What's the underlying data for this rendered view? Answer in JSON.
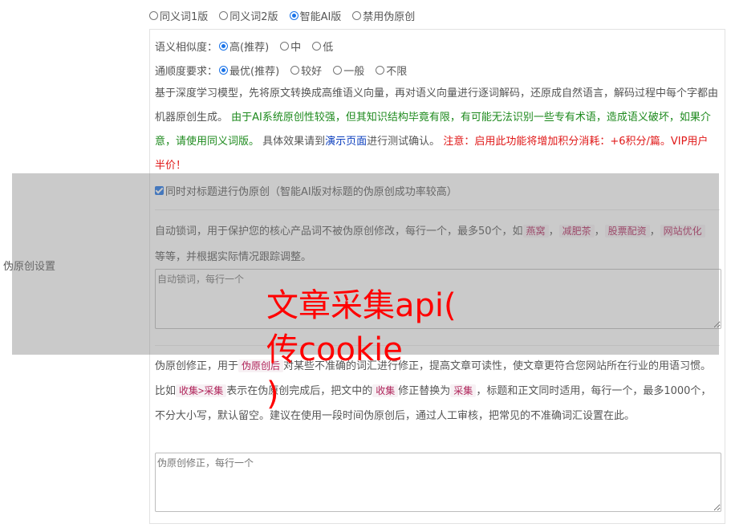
{
  "mode_options": [
    {
      "label": "同义词1版",
      "checked": false
    },
    {
      "label": "同义词2版",
      "checked": false
    },
    {
      "label": "智能AI版",
      "checked": true
    },
    {
      "label": "禁用伪原创",
      "checked": false
    }
  ],
  "similarity": {
    "label": "语义相似度：",
    "options": [
      {
        "label": "高(推荐)",
        "checked": true
      },
      {
        "label": "中",
        "checked": false
      },
      {
        "label": "低",
        "checked": false
      }
    ]
  },
  "fluency": {
    "label": "通顺度要求：",
    "options": [
      {
        "label": "最优(推荐)",
        "checked": true
      },
      {
        "label": "较好",
        "checked": false
      },
      {
        "label": "一般",
        "checked": false
      },
      {
        "label": "不限",
        "checked": false
      }
    ]
  },
  "description": {
    "part1": "基于深度学习模型，先将原文转换成高维语义向量，再对语义向量进行逐词解码，还原成自然语言，解码过程中每个字都由机器原创生成。 ",
    "warning_green": "由于AI系统原创性较强，但其知识结构毕竟有限，有可能无法识别一些专有术语，造成语义破坏，如果介意，请使用同义词版。",
    "part2": " 具体效果请到",
    "demo_link": "演示页面",
    "part3": "进行测试确认。 ",
    "warning_red": "注意：启用此功能将增加积分消耗：+6积分/篇。VIP用户半价！"
  },
  "title_checkbox": {
    "label": "同时对标题进行伪原创（智能AI版对标题的伪原创成功率较高）",
    "checked": true
  },
  "lock_words": {
    "intro": "自动锁词，用于保护您的核心产品词不被伪原创修改，每行一个，最多50个，如",
    "examples": [
      "燕窝",
      "减肥茶",
      "股票配资",
      "网站优化"
    ],
    "sep": "，",
    "outro": "等等，并根据实际情况跟踪调整。",
    "placeholder": "自动锁词，每行一个"
  },
  "side_label": "伪原创设置",
  "correction": {
    "text1": "伪原创修正，用于",
    "tag1": "伪原创后",
    "text2": "对某些不准确的词汇进行修正，提高文章可读性，使文章更符合您网站所在行业的用语习惯。比如",
    "tag2": "收集>采集",
    "text3": "表示在伪原创完成后，把文中的",
    "tag3": "收集",
    "text4": "修正替换为",
    "tag4": "采集",
    "text5": "，标题和正文同时适用，每行一个，最多1000个，不分大小写，默认留空。建议在使用一段时间伪原创后，通过人工审核，把常见的不准确词汇设置在此。",
    "placeholder": "伪原创修正，每行一个"
  },
  "watermark": {
    "line1": "文章采集api(",
    "line2": "传cookie",
    "line3": ")"
  }
}
